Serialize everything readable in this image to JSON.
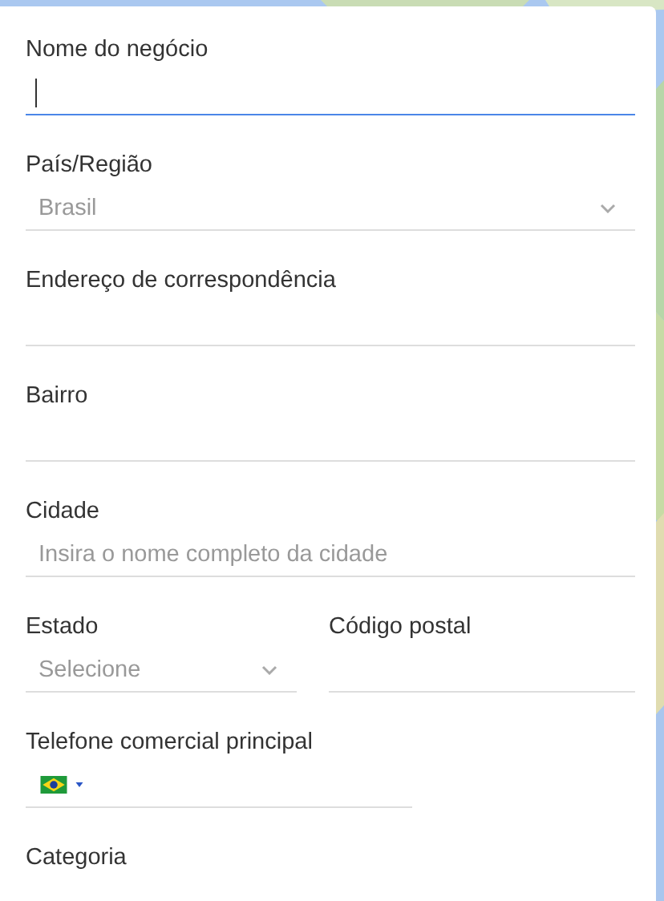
{
  "fields": [
    {
      "kind": "text",
      "label": "Nome do negócio",
      "focused": true
    },
    {
      "kind": "select",
      "label": "País/Região",
      "value": "Brasil",
      "focused": false
    },
    {
      "kind": "text",
      "label": "Endereço de correspondência",
      "focused": false
    },
    {
      "kind": "text",
      "label": "Bairro",
      "focused": false
    },
    {
      "kind": "text",
      "label": "Cidade",
      "placeholder": "Insira o nome completo da cidade",
      "focused": false
    },
    {
      "kind": "pair",
      "fields": [
        {
          "kind": "select",
          "label": "Estado",
          "value": "Selecione",
          "focused": false
        },
        {
          "kind": "text",
          "label": "Código postal",
          "focused": false
        }
      ]
    },
    {
      "kind": "phone",
      "label": "Telefone comercial principal",
      "focused": false
    },
    {
      "kind": "heading",
      "label": "Categoria"
    }
  ]
}
